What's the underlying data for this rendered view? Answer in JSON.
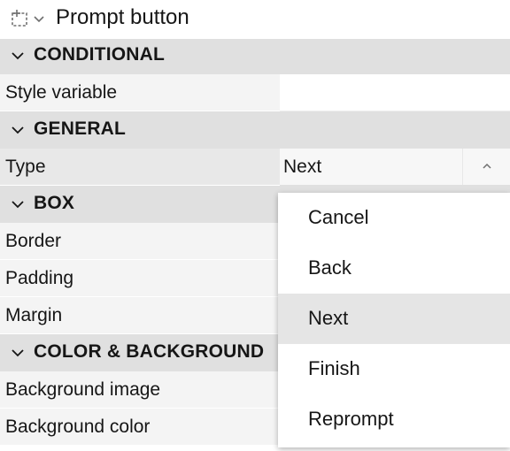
{
  "header": {
    "title": "Prompt button",
    "select_icon": "dashed-selection-icon",
    "menu_icon": "chevron-down-icon"
  },
  "sections": {
    "conditional": {
      "label": "CONDITIONAL"
    },
    "general": {
      "label": "GENERAL"
    },
    "box": {
      "label": "BOX"
    },
    "color_background": {
      "label": "COLOR & BACKGROUND"
    }
  },
  "properties": {
    "style_variable": {
      "label": "Style variable",
      "value": ""
    },
    "type": {
      "label": "Type",
      "value": "Next"
    },
    "border": {
      "label": "Border",
      "value": ""
    },
    "padding": {
      "label": "Padding",
      "value": ""
    },
    "margin": {
      "label": "Margin",
      "value": ""
    },
    "background_image": {
      "label": "Background image",
      "value": ""
    },
    "background_color": {
      "label": "Background color",
      "value": ""
    }
  },
  "type_dropdown": {
    "expanded": true,
    "selected": "Next",
    "options": [
      "Cancel",
      "Back",
      "Next",
      "Finish",
      "Reprompt"
    ]
  },
  "colors": {
    "section_bg": "#e0e0e0",
    "label_bg": "#f4f4f4",
    "highlight": "#e5e5e5",
    "text": "#161616"
  }
}
